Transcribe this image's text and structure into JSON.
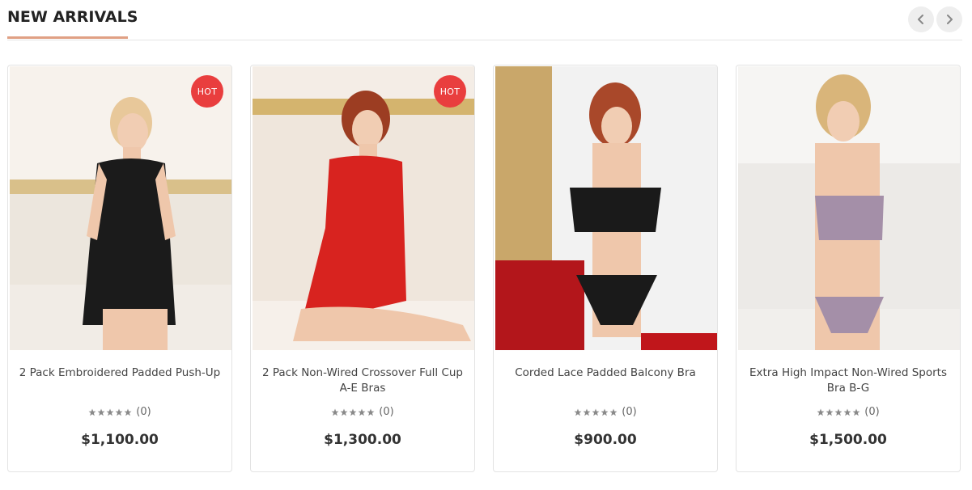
{
  "section": {
    "title": "NEW ARRIVALS",
    "accent_color": "#e0a084",
    "prev_icon": "chevron-left-icon",
    "next_icon": "chevron-right-icon"
  },
  "products": [
    {
      "name": "2 Pack Embroidered Padded Push-Up",
      "badge": "HOT",
      "rating_count": "(0)",
      "stars": 0,
      "price": "$1,100.00",
      "garment_color": "#1b1b1b"
    },
    {
      "name": "2 Pack Non-Wired Crossover Full Cup A-E Bras",
      "badge": "HOT",
      "rating_count": "(0)",
      "stars": 0,
      "price": "$1,300.00",
      "garment_color": "#d8231f"
    },
    {
      "name": "Corded Lace Padded Balcony Bra",
      "badge": "",
      "rating_count": "(0)",
      "stars": 0,
      "price": "$900.00",
      "garment_color": "#1a1a1a"
    },
    {
      "name": "Extra High Impact Non-Wired Sports Bra B-G",
      "badge": "",
      "rating_count": "(0)",
      "stars": 0,
      "price": "$1,500.00",
      "garment_color": "#a48fa8"
    }
  ],
  "colors": {
    "hot_badge": "#e93e3e",
    "star_empty": "#8a8a8a"
  }
}
